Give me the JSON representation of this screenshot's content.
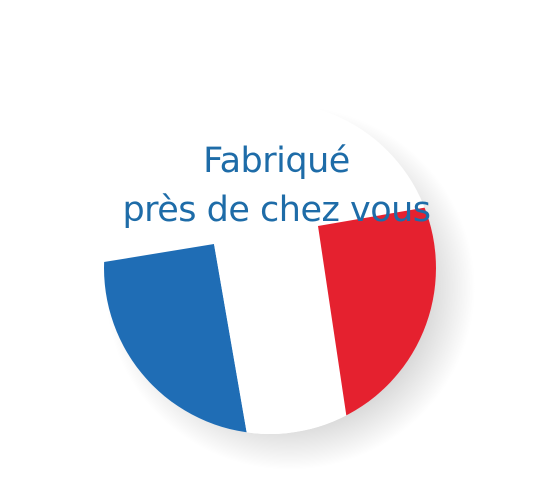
{
  "badge": {
    "line1": "Fabriqué",
    "line2": "près de chez vous"
  },
  "colors": {
    "text": "#1e6ca8",
    "flag_blue": "#1f6db5",
    "flag_white": "#ffffff",
    "flag_red": "#e5212f",
    "background": "#ffffff"
  },
  "icons": {
    "flag": "french-flag-icon"
  }
}
